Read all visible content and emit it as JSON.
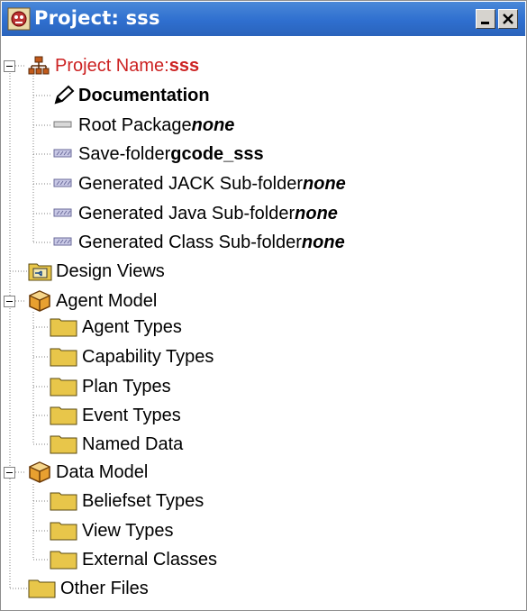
{
  "window": {
    "title": "Project: sss"
  },
  "controls": {
    "minimize": "_",
    "close": "×"
  },
  "tree": {
    "project": {
      "prefix": "Project Name: ",
      "name": "sss",
      "color": "#cc2222"
    },
    "project_children": [
      {
        "label": "Documentation",
        "value": "",
        "icon": "pencil-icon"
      },
      {
        "label": "Root Package ",
        "value": "none",
        "icon": "package-icon"
      },
      {
        "label": "Save-folder ",
        "value": "gcode_sss",
        "icon": "folder-path-icon"
      },
      {
        "label": "Generated JACK Sub-folder ",
        "value": "none",
        "icon": "folder-path-icon"
      },
      {
        "label": "Generated Java Sub-folder ",
        "value": "none",
        "icon": "folder-path-icon"
      },
      {
        "label": "Generated Class Sub-folder ",
        "value": "none",
        "icon": "folder-path-icon"
      }
    ],
    "design_views": "Design Views",
    "agent_model": {
      "label": "Agent Model",
      "children": [
        "Agent Types",
        "Capability Types",
        "Plan Types",
        "Event Types",
        "Named Data"
      ]
    },
    "data_model": {
      "label": "Data Model",
      "children": [
        "Beliefset Types",
        "View Types",
        "External Classes"
      ]
    },
    "other_files": "Other Files"
  },
  "colors": {
    "titlebar": "#2f6fcf",
    "folder": "#e8c64a",
    "tree_lines": "#808080"
  }
}
